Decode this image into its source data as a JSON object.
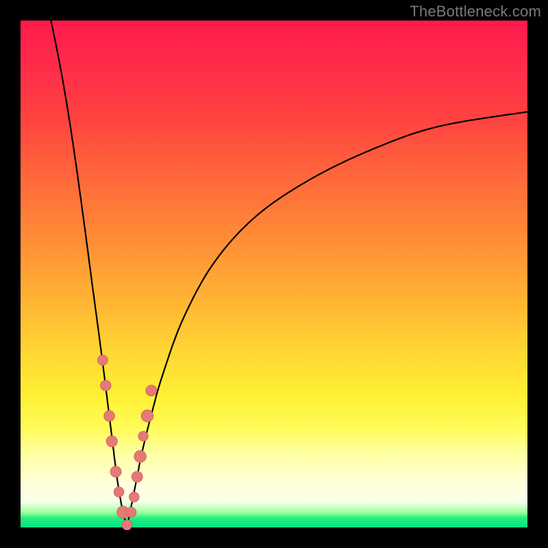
{
  "watermark": "TheBottleneck.com",
  "colors": {
    "frame": "#000000",
    "curve_stroke": "#000000",
    "dot_fill": "#e47a78",
    "dot_stroke": "#d46360",
    "gradient_top": "#ff1a4d",
    "gradient_bottom": "#00e08a"
  },
  "chart_data": {
    "type": "line",
    "title": "",
    "xlabel": "",
    "ylabel": "",
    "xlim": [
      0,
      100
    ],
    "ylim": [
      0,
      100
    ],
    "notes": "V-shaped bottleneck curve. y≈0 (green, no bottleneck) at x≈21; y rises steeply on both sides toward red. Left branch hits top edge near x≈6; right branch exits right edge near y≈82.",
    "series": [
      {
        "name": "bottleneck-curve-left",
        "x": [
          6,
          8,
          10,
          12,
          14,
          16,
          18,
          19,
          20,
          21
        ],
        "y": [
          100,
          90,
          78,
          64,
          49,
          34,
          18,
          10,
          4,
          0
        ]
      },
      {
        "name": "bottleneck-curve-right",
        "x": [
          21,
          22,
          23,
          24,
          26,
          28,
          32,
          38,
          46,
          56,
          68,
          82,
          100
        ],
        "y": [
          0,
          5,
          10,
          15,
          23,
          30,
          41,
          52,
          61,
          68,
          74,
          79,
          82
        ]
      }
    ],
    "dots": {
      "name": "sample-points",
      "x": [
        16.2,
        16.8,
        17.5,
        18.0,
        18.8,
        19.4,
        20.2,
        21.0,
        21.8,
        22.4,
        23.0,
        23.6,
        24.2,
        25.0,
        25.8
      ],
      "y": [
        33,
        28,
        22,
        17,
        11,
        7,
        3,
        0.5,
        3,
        6,
        10,
        14,
        18,
        22,
        27
      ]
    }
  }
}
